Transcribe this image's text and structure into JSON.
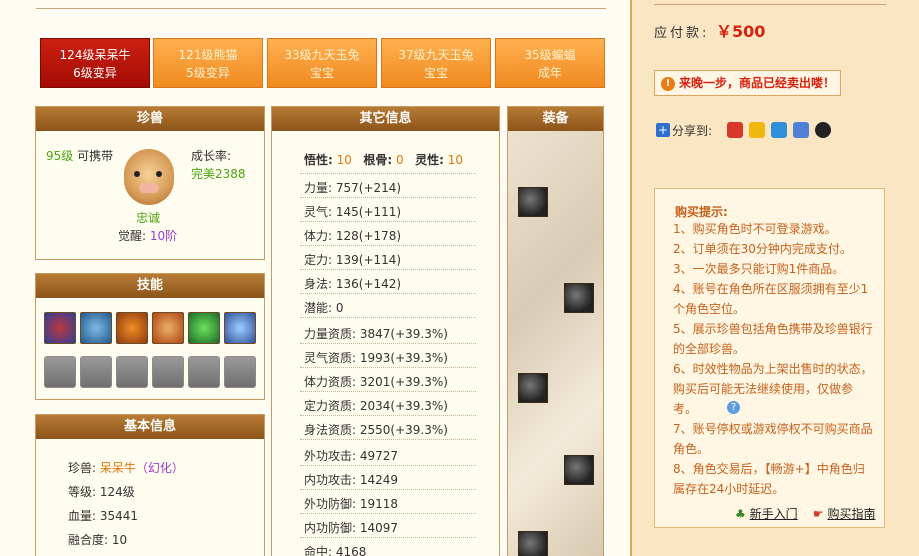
{
  "tabs": [
    {
      "line1": "124级呆呆牛",
      "line2": "6级变异",
      "active": true
    },
    {
      "line1": "121级熊猫",
      "line2": "5级变异",
      "active": false
    },
    {
      "line1": "33级九天玉兔",
      "line2": "宝宝",
      "active": false
    },
    {
      "line1": "37级九天玉兔",
      "line2": "宝宝",
      "active": false
    },
    {
      "line1": "35级蝙蝠",
      "line2": "成年",
      "active": false
    }
  ],
  "pet": {
    "title": "珍兽",
    "level": "95级",
    "carry": "可携带",
    "growth_label": "成长率:",
    "growth_value": "完美2388",
    "loyalty": "忠诚",
    "awaken_label": "觉醒:",
    "awaken_value": "10阶"
  },
  "skills": {
    "title": "技能",
    "icons": [
      "skill-1-icon",
      "skill-2-icon",
      "skill-3-icon",
      "skill-4-icon",
      "skill-5-icon",
      "skill-6-icon"
    ],
    "colors": [
      "#2b3f9a",
      "#1f5a8e",
      "#8c3a12",
      "#b04410",
      "#1b6a2a",
      "#2c4f9c"
    ]
  },
  "basic": {
    "title": "基本信息",
    "rows": [
      {
        "label": "珍兽:",
        "value": "呆呆牛",
        "extra": "（幻化）"
      },
      {
        "label": "等级:",
        "value": "124级"
      },
      {
        "label": "血量:",
        "value": "35441"
      },
      {
        "label": "融合度:",
        "value": "10"
      }
    ]
  },
  "other": {
    "title": "其它信息",
    "wuxing_label": "悟性:",
    "wuxing": "10",
    "gengu_label": "根骨:",
    "gengu": "0",
    "lingxing_label": "灵性:",
    "lingxing": "10",
    "stats": [
      {
        "label": "力量:",
        "value": "757(+214)"
      },
      {
        "label": "灵气:",
        "value": "145(+111)"
      },
      {
        "label": "体力:",
        "value": "128(+178)"
      },
      {
        "label": "定力:",
        "value": "139(+114)"
      },
      {
        "label": "身法:",
        "value": "136(+142)"
      }
    ],
    "potential_label": "潜能:",
    "potential": "0",
    "aptitudes": [
      {
        "label": "力量资质:",
        "value": "3847(+39.3%)"
      },
      {
        "label": "灵气资质:",
        "value": "1993(+39.3%)"
      },
      {
        "label": "体力资质:",
        "value": "3201(+39.3%)"
      },
      {
        "label": "定力资质:",
        "value": "2034(+39.3%)"
      },
      {
        "label": "身法资质:",
        "value": "2550(+39.3%)"
      }
    ],
    "combat": [
      {
        "label": "外功攻击:",
        "value": "49727"
      },
      {
        "label": "内功攻击:",
        "value": "14249"
      },
      {
        "label": "外功防御:",
        "value": "19118"
      },
      {
        "label": "内功防御:",
        "value": "14097"
      },
      {
        "label": "命中:",
        "value": "4168"
      }
    ]
  },
  "equipment": {
    "title": "装备"
  },
  "right": {
    "price_label": "应付款:",
    "price": "￥500",
    "sold_notice": "来晚一步，商品已经卖出喽！",
    "share_label": "分享到:",
    "tips_title": "购买提示:",
    "tips": [
      "1、购买角色时不可登录游戏。",
      "2、订单须在30分钟内完成支付。",
      "3、一次最多只能订购1件商品。",
      "4、账号在角色所在区服须拥有至少1个角色空位。",
      "5、展示珍兽包括角色携带及珍兽银行的全部珍兽。",
      "6、时效性物品为上架出售时的状态，购买后可能无法继续使用，仅做参考。",
      "7、账号停权或游戏停权不可购买商品角色。",
      "8、角色交易后，【畅游+】中角色归属存在24小时延迟。"
    ],
    "link_newbie": "新手入门",
    "link_guide": "购买指南"
  }
}
